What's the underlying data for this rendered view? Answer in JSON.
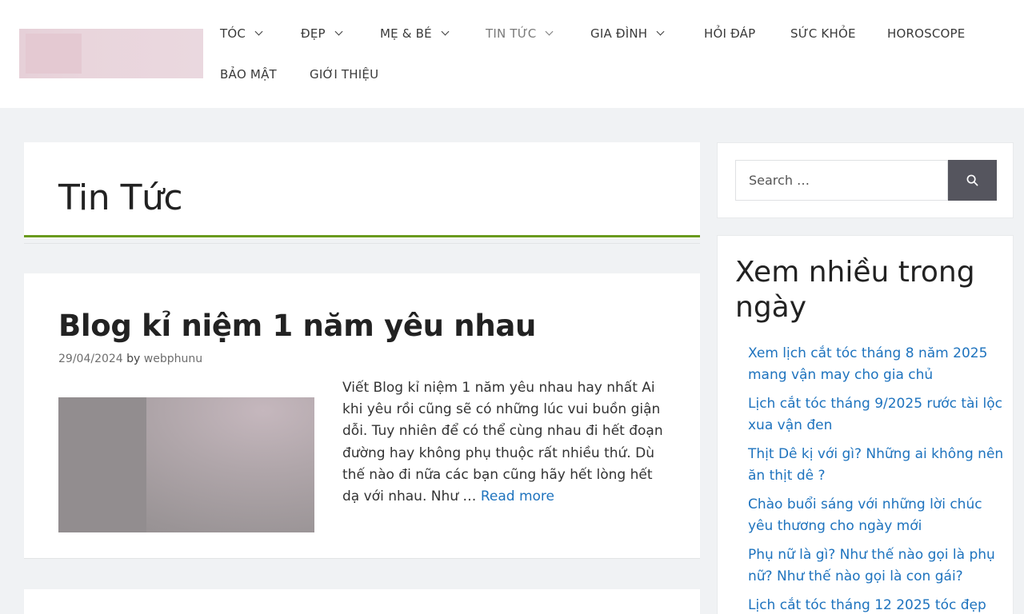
{
  "nav": {
    "items": [
      {
        "label": "TÓC",
        "has_dropdown": true
      },
      {
        "label": "ĐẸP",
        "has_dropdown": true
      },
      {
        "label": "MẸ & BÉ",
        "has_dropdown": true
      },
      {
        "label": "TIN TỨC",
        "has_dropdown": true,
        "active": true
      },
      {
        "label": "GIA ĐÌNH",
        "has_dropdown": true
      },
      {
        "label": "HỎI ĐÁP",
        "has_dropdown": false
      },
      {
        "label": "SỨC KHỎE",
        "has_dropdown": false
      },
      {
        "label": "HOROSCOPE",
        "has_dropdown": false
      },
      {
        "label": "BẢO MẬT",
        "has_dropdown": false
      },
      {
        "label": "GIỚI THIỆU",
        "has_dropdown": false
      }
    ]
  },
  "page": {
    "title": "Tin Tức"
  },
  "post": {
    "title": "Blog kỉ niệm 1 năm yêu nhau",
    "date": "29/04/2024",
    "by_label": "by",
    "author": "webphunu",
    "excerpt": "Viết Blog kỉ niệm 1 năm yêu nhau hay nhất  Ai khi yêu rồi cũng sẽ có những lúc vui buồn giận dỗi. Tuy nhiên để có thể cùng nhau đi hết đoạn đường hay không phụ thuộc rất nhiều thứ. Dù thế nào đi nữa các bạn cũng hãy hết lòng hết dạ với nhau. Như … ",
    "read_more": "Read more"
  },
  "sidebar": {
    "search": {
      "placeholder": "Search …",
      "icon": "search-icon"
    },
    "widget": {
      "title": "Xem nhiều trong ngày",
      "items": [
        "Xem lịch cắt tóc tháng 8 năm 2025 mang vận may cho gia chủ",
        "Lịch cắt tóc tháng 9/2025 rước tài lộc xua vận đen",
        "Thịt Dê kị với gì? Những ai không nên ăn thịt dê ?",
        "Chào buổi sáng với những lời chúc yêu thương cho ngày mới",
        "Phụ nữ là gì? Như thế nào gọi là phụ nữ? Như thế nào gọi là con gái?",
        "Lịch cắt tóc tháng 12 2025 tóc đẹp"
      ]
    }
  },
  "colors": {
    "accent_green": "#6a9a1f",
    "link_blue": "#1e73be",
    "search_button": "#55555e"
  }
}
